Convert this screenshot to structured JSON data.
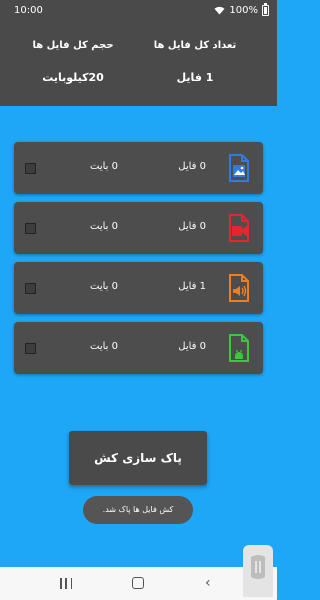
{
  "status_bar": {
    "time": "10:00",
    "battery": "100%"
  },
  "header": {
    "total_files_label": "تعداد کل فایل ها",
    "total_files_value": "1 فایل",
    "total_size_label": "حجم کل فایل ها",
    "total_size_value": "20کیلوبایت"
  },
  "categories": [
    {
      "name": "image",
      "icon": "image-file-icon",
      "color": "#2f7ce0",
      "count": "0 فایل",
      "size": "0 بایت",
      "checked": false
    },
    {
      "name": "video",
      "icon": "video-file-icon",
      "color": "#e3262f",
      "count": "0 فایل",
      "size": "0 بایت",
      "checked": false
    },
    {
      "name": "audio",
      "icon": "audio-file-icon",
      "color": "#f07d1e",
      "count": "1 فایل",
      "size": "0 بایت",
      "checked": false
    },
    {
      "name": "apk",
      "icon": "apk-file-icon",
      "color": "#3ac93a",
      "count": "0 فایل",
      "size": "0 بایت",
      "checked": false
    }
  ],
  "clean_button": {
    "label": "پاک سازی کش"
  },
  "toast": {
    "message": "کش فایل ها پاک شد."
  },
  "colors": {
    "background": "#1ea7f6",
    "panel": "#4a4a4a"
  }
}
